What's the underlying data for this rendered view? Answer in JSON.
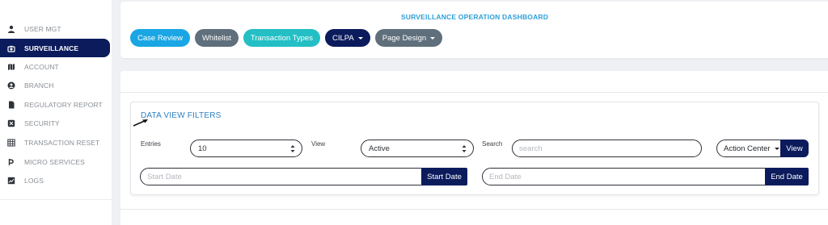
{
  "sidebar": {
    "items": [
      {
        "label": "USER MGT",
        "icon": "user-icon"
      },
      {
        "label": "SURVEILLANCE",
        "icon": "camera-icon",
        "active": true
      },
      {
        "label": "ACCOUNT",
        "icon": "map-icon"
      },
      {
        "label": "BRANCH",
        "icon": "user-circle-icon"
      },
      {
        "label": "REGULATORY REPORT",
        "icon": "file-icon"
      },
      {
        "label": "SECURITY",
        "icon": "shield-icon"
      },
      {
        "label": "TRANSACTION RESET",
        "icon": "grid-icon"
      },
      {
        "label": "MICRO SERVICES",
        "icon": "plug-icon"
      },
      {
        "label": "LOGS",
        "icon": "chart-icon"
      }
    ]
  },
  "header": {
    "title": "SURVEILLANCE OPERATION DASHBOARD",
    "pills": [
      {
        "label": "Case Review",
        "color": "#1aa6e4"
      },
      {
        "label": "Whitelist",
        "color": "#5f6f7c"
      },
      {
        "label": "Transaction Types",
        "color": "#23bfc5"
      },
      {
        "label": "CILPA",
        "color": "#0b1b5c",
        "dropdown": true
      },
      {
        "label": "Page Design",
        "color": "#5f6f7c",
        "dropdown": true
      }
    ]
  },
  "filters": {
    "title": "DATA VIEW FILTERS",
    "entries_label": "Entries",
    "entries_value": "10",
    "view_label": "View",
    "view_value": "Active",
    "search_label": "Search",
    "search_placeholder": "search",
    "action_center_label": "Action Center",
    "view_button": "View",
    "start_date_placeholder": "Start Date",
    "start_date_button": "Start Date",
    "end_date_placeholder": "End Date",
    "end_date_button": "End Date"
  },
  "colors": {
    "accent": "#2d9fd9",
    "navy": "#0b1b5c"
  }
}
